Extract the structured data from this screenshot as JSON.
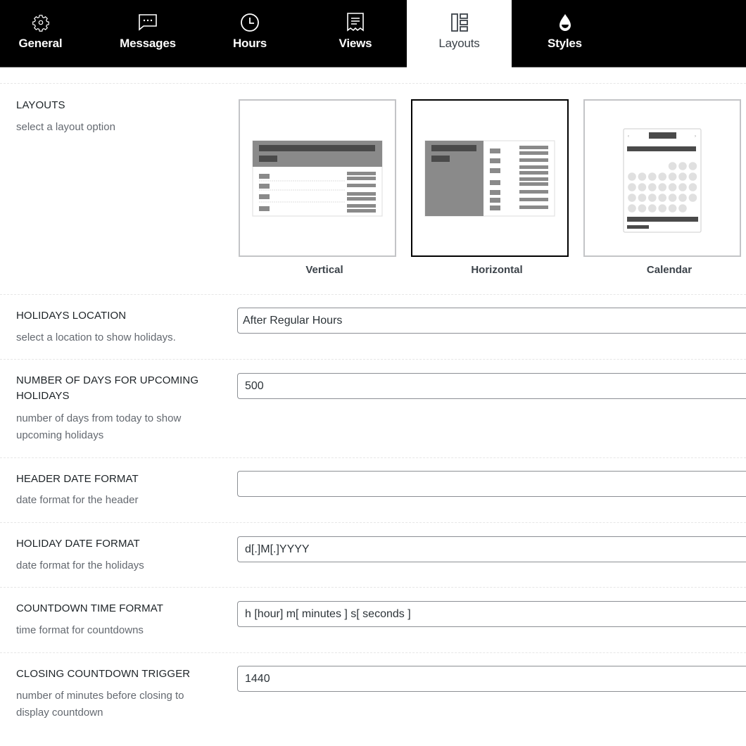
{
  "tabs": [
    {
      "label": "General",
      "icon": "gear-icon",
      "active": false
    },
    {
      "label": "Messages",
      "icon": "chat-bubble-icon",
      "active": false
    },
    {
      "label": "Hours",
      "icon": "clock-icon",
      "active": false
    },
    {
      "label": "Views",
      "icon": "receipt-icon",
      "active": false
    },
    {
      "label": "Layouts",
      "icon": "layout-icon",
      "active": true
    },
    {
      "label": "Styles",
      "icon": "droplet-icon",
      "active": false
    }
  ],
  "layouts": {
    "label": "LAYOUTS",
    "description": "select a layout option",
    "options": [
      {
        "name": "Vertical",
        "selected": false
      },
      {
        "name": "Horizontal",
        "selected": true
      },
      {
        "name": "Calendar",
        "selected": false
      }
    ]
  },
  "holidays_location": {
    "label": "HOLIDAYS LOCATION",
    "description": "select a location to show holidays.",
    "value": "After Regular Hours"
  },
  "upcoming_days": {
    "label_line1": "NUMBER OF DAYS FOR UPCOMING",
    "label_line2": "HOLIDAYS",
    "description_line1": "number of days from today to show",
    "description_line2": "upcoming holidays",
    "value": "500"
  },
  "header_date_format": {
    "label": "HEADER DATE FORMAT",
    "description": "date format for the header",
    "value": ""
  },
  "holiday_date_format": {
    "label": "HOLIDAY DATE FORMAT",
    "description": "date format for the holidays",
    "value": "d[.]M[.]YYYY"
  },
  "countdown_time_format": {
    "label": "COUNTDOWN TIME FORMAT",
    "description": "time format for countdowns",
    "value": "h [hour] m[ minutes ] s[ seconds ]"
  },
  "closing_countdown_trigger": {
    "label": "CLOSING COUNTDOWN TRIGGER",
    "description_line1": "number of minutes before closing to",
    "description_line2": "display countdown",
    "value": "1440"
  }
}
